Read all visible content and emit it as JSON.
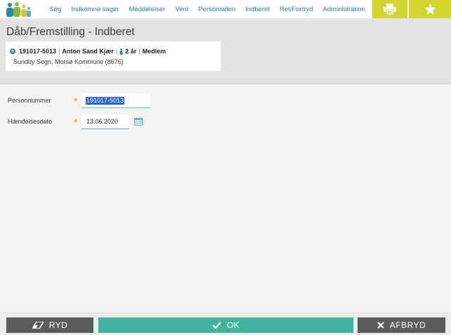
{
  "nav": {
    "items": [
      {
        "label": "Søg"
      },
      {
        "label": "Indkomne sager"
      },
      {
        "label": "Meddelelser"
      },
      {
        "label": "Vent"
      },
      {
        "label": "Personsiden"
      },
      {
        "label": "Indberet"
      },
      {
        "label": "Ret/Fortryd"
      },
      {
        "label": "Administration"
      }
    ],
    "print_icon": "print-icon",
    "star_icon": "star-icon",
    "accent_color": "#d2d52f"
  },
  "header": {
    "title": "Dåb/Fremstilling - Indberet"
  },
  "person": {
    "cpr": "191017-5013",
    "name": "Anton Sand Kjær",
    "age": "2 år",
    "status": "Medlem",
    "parish": "Sundby Sogn, Morsø Kommune (8676)"
  },
  "form": {
    "personnummer_label": "Personnummer",
    "personnummer_value": "191017-5013",
    "haendelsesdato_label": "Hændelsesdato",
    "haendelsesdato_value": "13.06.2020"
  },
  "buttons": {
    "ryd": "RYD",
    "ok": "OK",
    "afbryd": "AFBRYD"
  }
}
